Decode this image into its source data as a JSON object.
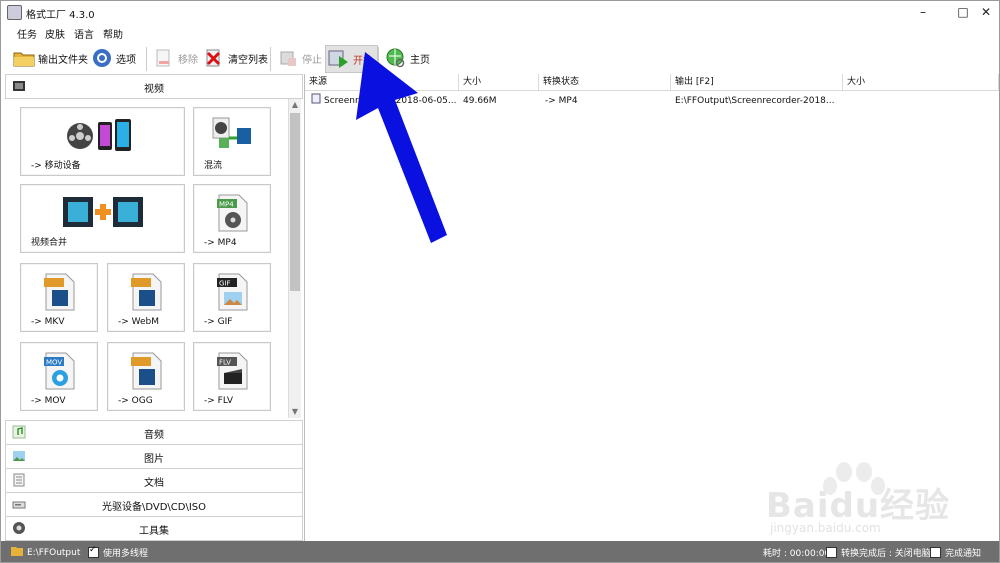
{
  "window": {
    "title": "格式工厂 4.3.0"
  },
  "menu": [
    "任务",
    "皮肤",
    "语言",
    "帮助"
  ],
  "toolbar": {
    "output_folder": "输出文件夹",
    "options": "选项",
    "remove": "移除",
    "clear_list": "清空列表",
    "stop": "停止",
    "start": "开始",
    "home": "主页"
  },
  "categories": {
    "video": "视频",
    "audio": "音频",
    "picture": "图片",
    "document": "文档",
    "disc": "光驱设备\\DVD\\CD\\ISO",
    "tools": "工具集"
  },
  "tiles": {
    "mobile": "-> 移动设备",
    "mix": "混流",
    "merge": "视频合并",
    "mp4": "-> MP4",
    "mkv": "-> MKV",
    "webm": "-> WebM",
    "gif": "-> GIF",
    "mov": "-> MOV",
    "ogg": "-> OGG",
    "flv": "-> FLV"
  },
  "tile_badges": {
    "mp4": "MP4",
    "gif": "GIF",
    "mov": "MOV",
    "flv": "FLV"
  },
  "table": {
    "columns": [
      "来源",
      "大小",
      "转换状态",
      "输出 [F2]",
      "大小"
    ],
    "rows": [
      {
        "source": "Screenrecorder-2018-06-05...",
        "size": "49.66M",
        "status": "-> MP4",
        "output": "E:\\FFOutput\\Screenrecorder-2018...",
        "out_size": ""
      }
    ]
  },
  "status": {
    "output_path": "E:\\FFOutput",
    "multithread": "使用多线程",
    "elapsed": "耗时 : 00:00:00",
    "after_convert": "转换完成后 : 关闭电脑",
    "notify": "完成通知"
  },
  "watermark": {
    "brand": "Baidu经验",
    "url": "jingyan.baidu.com"
  },
  "colors": {
    "arrow": "#0a10e0",
    "statusbar": "#6f6f6f",
    "start_text": "#c0392b"
  }
}
